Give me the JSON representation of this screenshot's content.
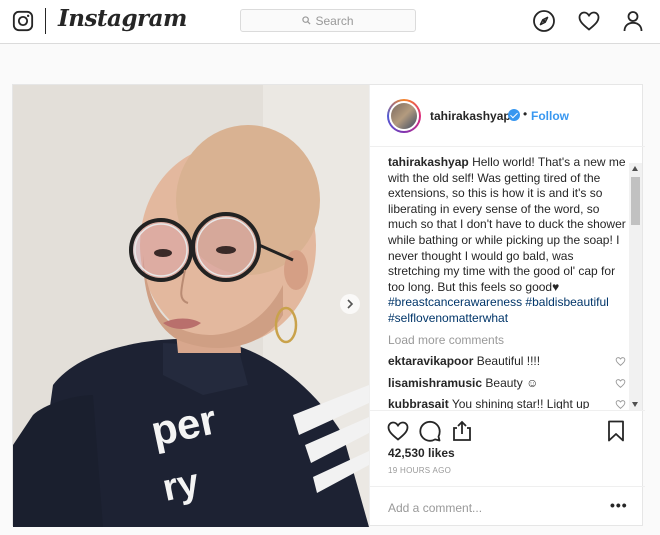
{
  "header": {
    "logo_text": "Instagram",
    "search_placeholder": "Search",
    "icons": [
      "instagram-glyph-icon",
      "explore-compass-icon",
      "activity-heart-icon",
      "profile-user-icon"
    ]
  },
  "post": {
    "username": "tahirakashyap",
    "follow_label": "Follow",
    "dot": "•",
    "caption": {
      "username": "tahirakashyap",
      "text": "Hello world! That's a new me with the old self! Was getting tired of the extensions, so this is how it is and it's so liberating in every sense of the word, so much so that I don't have to duck the shower while bathing or while picking up the soap! I never thought I would go bald, was stretching my time with the good ol' cap for too long. But this feels so good♥",
      "hashtags": [
        "#breastcancerawareness",
        "#baldisbeautiful",
        "#selflovenomatterwhat"
      ]
    },
    "load_more": "Load more comments",
    "comments": [
      {
        "user": "ektaravikapoor",
        "text": "Beautiful !!!!"
      },
      {
        "user": "lisamishramusic",
        "text": "Beauty ☺"
      },
      {
        "user": "kubbrasait",
        "text": "You shining star!! Light up the world!! ☺"
      }
    ],
    "likes": "42,530 likes",
    "time": "19 HOURS AGO",
    "add_comment_placeholder": "Add a comment...",
    "more_label": "•••"
  },
  "colors": {
    "link_blue": "#3897f0",
    "hashtag": "#003569",
    "muted": "#999999",
    "text": "#262626"
  }
}
